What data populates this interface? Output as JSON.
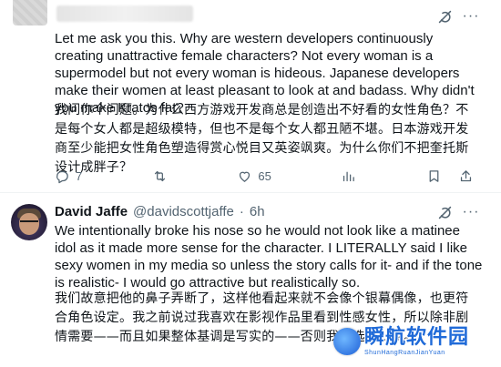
{
  "tweet1": {
    "text_en": "Let me ask you this. Why are western developers continuously creating unattractive female characters? Not every woman is a supermodel but not every woman is hideous. Japanese developers make their women at least pleasant to look at and badass. Why didn't you make Kratos fat?",
    "text_zh": "我问你个问题。为什么西方游戏开发商总是创造出不好看的女性角色？不是每个女人都是超级模特，但也不是每个女人都丑陋不堪。日本游戏开发商至少能把女性角色塑造得赏心悦目又英姿飒爽。为什么你们不把奎托斯设计成胖子？",
    "reply_count": "7",
    "like_count": "65"
  },
  "tweet2": {
    "author_name": "David Jaffe",
    "handle": "@davidscottjaffe",
    "dot": "·",
    "time": "6h",
    "text_en": "We intentionally broke his nose so he would not look like a matinee idol as it made more sense for the character. I LITERALLY said I like sexy women in my media so unless the story calls for it- and if the tone is realistic- I would go attractive but realistically so.",
    "text_zh": "我们故意把他的鼻子弄断了，这样他看起来就不会像个银幕偶像，也更符合角色设定。我之前说过我喜欢在影视作品里看到性感女性，所以除非剧情需要——而且如果整体基调是写实的——否则我会选择...象。"
  },
  "watermark": {
    "main": "瞬航软件园",
    "sub": "ShunHangRuanJianYuan"
  },
  "icons": {
    "grok": "grok-icon",
    "more": "more-icon",
    "reply": "reply-icon",
    "retweet": "retweet-icon",
    "like": "like-icon",
    "views": "views-icon",
    "bookmark": "bookmark-icon",
    "share": "share-icon"
  },
  "colors": {
    "text": "#0f1419",
    "secondary": "#536471",
    "divider": "#eff3f4",
    "watermark": "#1f6ad8"
  }
}
